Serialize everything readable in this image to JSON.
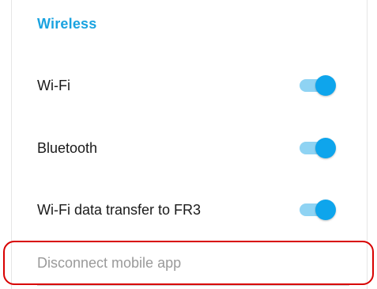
{
  "section": {
    "title": "Wireless"
  },
  "settings": [
    {
      "label": "Wi-Fi",
      "enabled": true
    },
    {
      "label": "Bluetooth",
      "enabled": true
    },
    {
      "label": "Wi-Fi data transfer to FR3",
      "enabled": true
    }
  ],
  "disconnect": {
    "label": "Disconnect mobile app"
  },
  "colors": {
    "accent": "#1aa3e0",
    "toggle_knob": "#0ea5ec",
    "toggle_track": "#8fd3f3",
    "annotation": "#d80000",
    "disabled_text": "#9a9a9a"
  }
}
